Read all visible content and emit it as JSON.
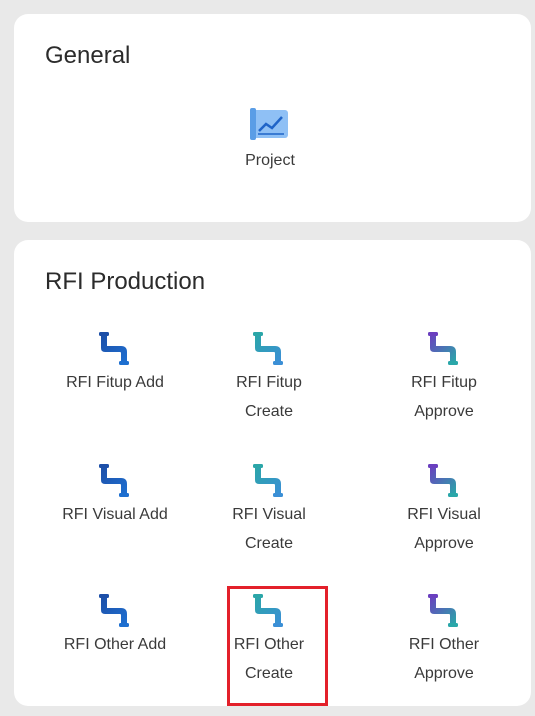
{
  "general": {
    "title": "General",
    "items": [
      {
        "label": "Project",
        "icon": "project-chart-icon"
      }
    ]
  },
  "rfi": {
    "title": "RFI Production",
    "items": [
      {
        "label": "RFI Fitup Add",
        "icon": "pipe-add-icon"
      },
      {
        "label": "RFI Fitup\nCreate",
        "icon": "pipe-create-icon"
      },
      {
        "label": "RFI Fitup\nApprove",
        "icon": "pipe-approve-icon"
      },
      {
        "label": "RFI Visual Add",
        "icon": "pipe-add-icon"
      },
      {
        "label": "RFI Visual\nCreate",
        "icon": "pipe-create-icon"
      },
      {
        "label": "RFI Visual\nApprove",
        "icon": "pipe-approve-icon"
      },
      {
        "label": "RFI Other Add",
        "icon": "pipe-add-icon"
      },
      {
        "label": "RFI Other\nCreate",
        "icon": "pipe-create-icon"
      },
      {
        "label": "RFI Other\nApprove",
        "icon": "pipe-approve-icon"
      }
    ]
  },
  "colors": {
    "highlight": "#e3202a",
    "pipe_add": [
      "#1d4fa8",
      "#1e6fd0"
    ],
    "pipe_create": [
      "#2ba6a8",
      "#3b8fd6"
    ],
    "pipe_approve": [
      "#6a3fbf",
      "#2aa7a9"
    ],
    "project_icon": "#7fb6f0"
  }
}
